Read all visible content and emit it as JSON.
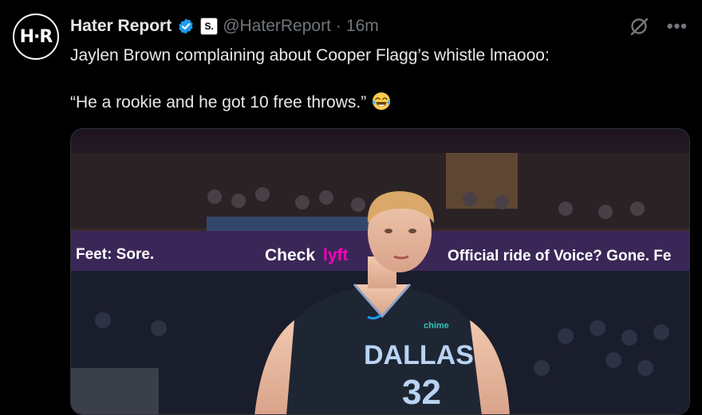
{
  "author": {
    "avatar_text": "H·R",
    "display_name": "Hater Report",
    "affiliate_badge": "S.",
    "handle": "@HaterReport",
    "separator": "·",
    "time": "16m"
  },
  "tweet": {
    "line1": "Jaylen Brown complaining about Cooper Flagg’s whistle lmaooo:",
    "line2": "“He a rookie and he got 10 free throws.”",
    "emoji_name": "face-with-tears-of-joy"
  },
  "media": {
    "banner_left": "Feet: Sore.",
    "banner_center_1": "Check",
    "banner_center_2": "lyft",
    "banner_right": "Official ride of Voice? Gone. Fe",
    "jersey_team": "DALLAS",
    "jersey_number": "32",
    "jersey_sponsor": "chime"
  },
  "colors": {
    "background": "#000000",
    "text": "#e7e9ea",
    "muted": "#71767b",
    "verified": "#1d9bf0",
    "lyft": "#ff00bf",
    "jersey": "#1e2633"
  }
}
